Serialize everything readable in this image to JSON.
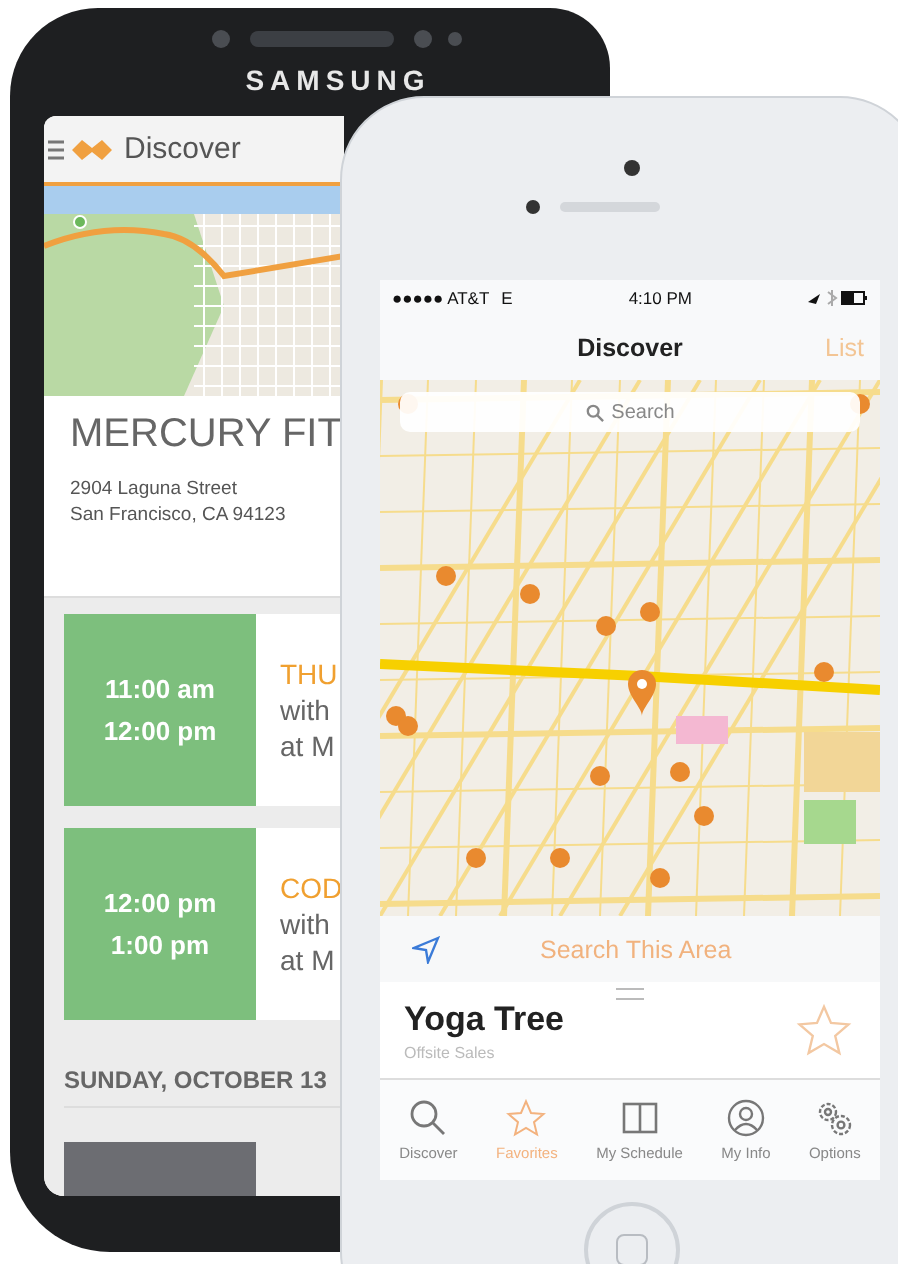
{
  "android": {
    "brand": "SAMSUNG",
    "app_bar": {
      "title": "Discover"
    },
    "venue": {
      "name": "MERCURY FIT",
      "address": [
        "2904 Laguna Street",
        "San Francisco, CA 94123"
      ]
    },
    "sessions": [
      {
        "start": "11:00 am",
        "end": "12:00 pm",
        "title": "THU",
        "lines": [
          "with",
          "at M"
        ]
      },
      {
        "start": "12:00 pm",
        "end": "1:00 pm",
        "title": "COD",
        "lines": [
          "with",
          "at M"
        ]
      }
    ],
    "day_header": "SUNDAY, OCTOBER 13"
  },
  "iphone": {
    "status_bar": {
      "carrier": "●●●●● AT&T",
      "network": "E",
      "time": "4:10 PM"
    },
    "nav": {
      "title": "Discover",
      "action": "List"
    },
    "search": {
      "placeholder": "Search"
    },
    "search_area": "Search This Area",
    "place": {
      "name": "Yoga Tree",
      "subtitle": "Offsite Sales",
      "favorite": false
    },
    "tabs": [
      {
        "label": "Discover",
        "selected": false
      },
      {
        "label": "Favorites",
        "selected": true
      },
      {
        "label": "My Schedule",
        "selected": false
      },
      {
        "label": "My Info",
        "selected": false
      },
      {
        "label": "Options",
        "selected": false
      }
    ]
  }
}
